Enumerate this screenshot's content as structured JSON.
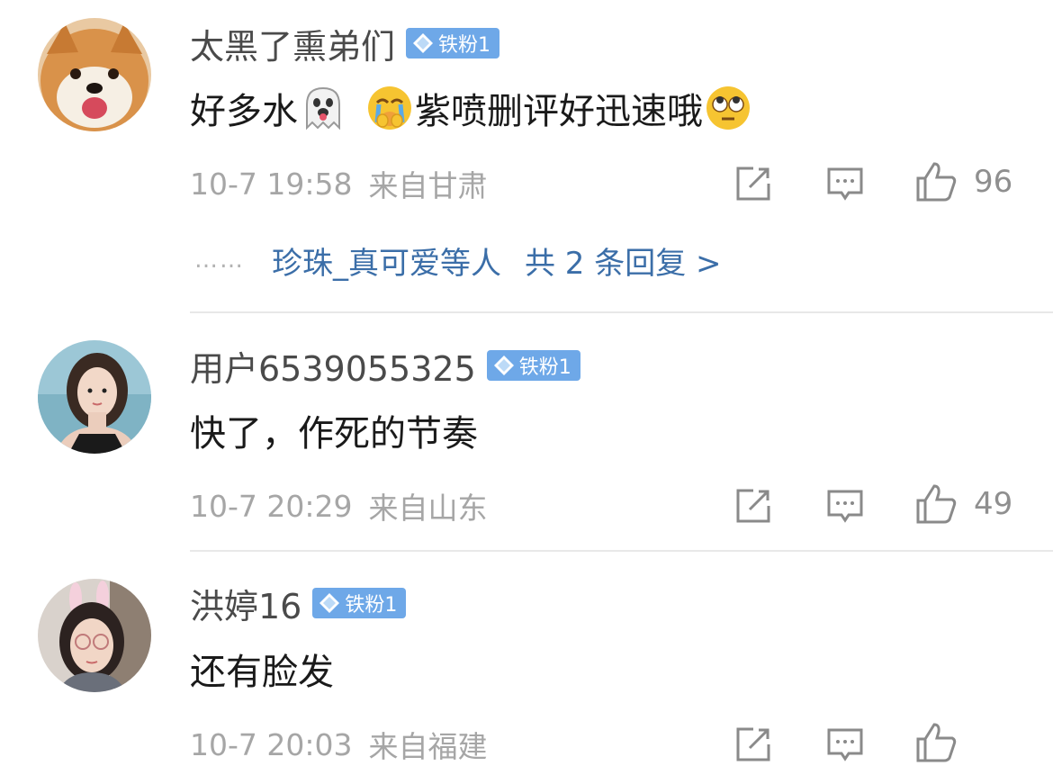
{
  "comments": [
    {
      "username": "太黑了熏弟们",
      "badge": "铁粉1",
      "content_before": "好多水",
      "content_middle": "",
      "content_after": "紫喷删评好迅速哦",
      "emojis": [
        "ghost-tongue-emoji",
        "crying-face-emoji",
        "eye-roll-emoji"
      ],
      "time": "10-7 19:58",
      "location": "来自甘肃",
      "likes": "96",
      "reply_users": "珍珠_真可爱等人",
      "reply_total": "共 2 条回复 >"
    },
    {
      "username": "用户6539055325",
      "badge": "铁粉1",
      "content": "快了，作死的节奏",
      "time": "10-7 20:29",
      "location": "来自山东",
      "likes": "49"
    },
    {
      "username": "洪婷16",
      "badge": "铁粉1",
      "content": "还有脸发",
      "time": "10-7 20:03",
      "location": "来自福建"
    }
  ],
  "replies_dots": "……",
  "colors": {
    "badge": "#6ea8e8",
    "link": "#3b6ea8",
    "meta": "#a6a6a6",
    "divider": "#e8e8e8"
  },
  "icons": [
    "share-icon",
    "comment-icon",
    "like-icon"
  ]
}
